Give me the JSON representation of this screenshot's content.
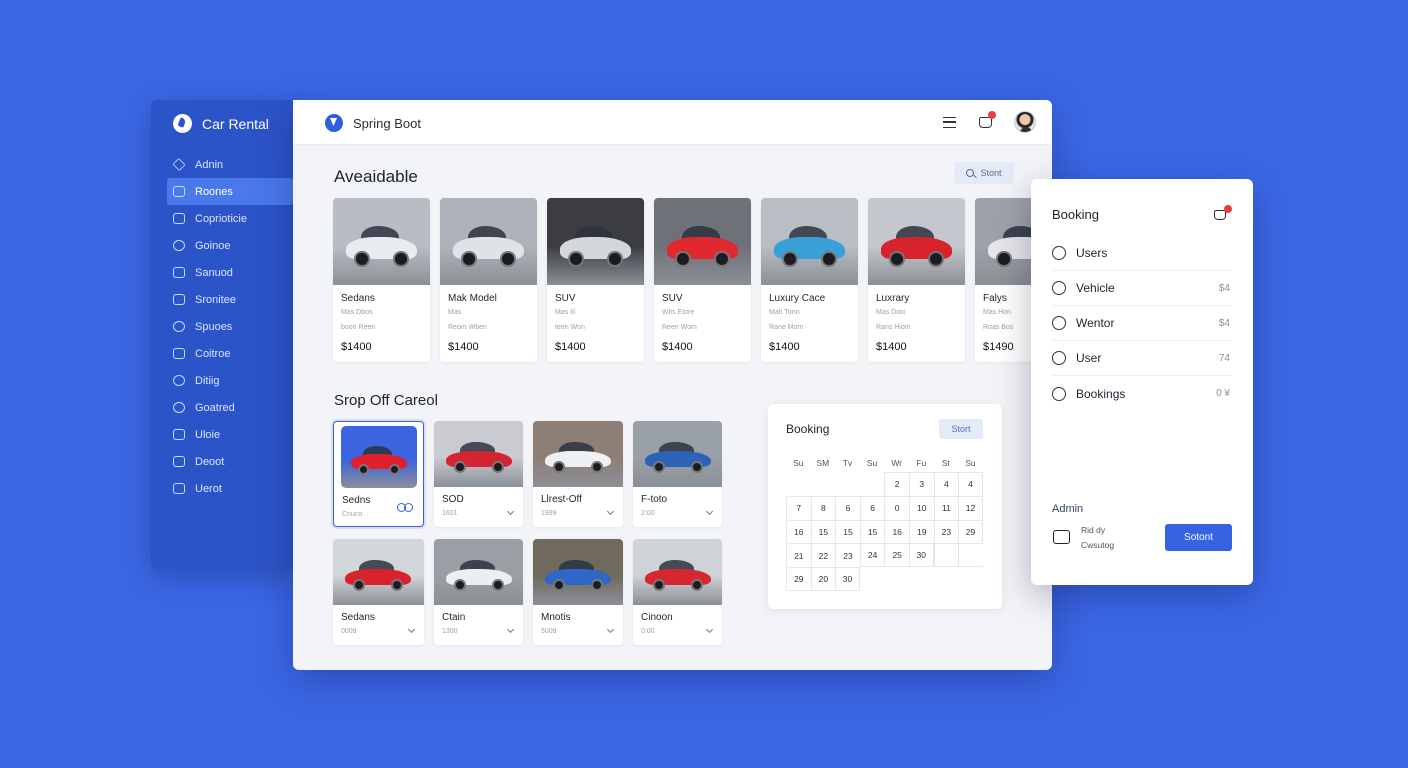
{
  "sidebar": {
    "brand": "Car Rental",
    "items": [
      {
        "label": "Adnin",
        "icon": "home-icon",
        "active": false
      },
      {
        "label": "Roones",
        "icon": "database-icon",
        "active": true
      },
      {
        "label": "Coprioticie",
        "icon": "lock-icon",
        "active": false
      },
      {
        "label": "Goinoe",
        "icon": "heart-icon",
        "active": false
      },
      {
        "label": "Sanuod",
        "icon": "card-icon",
        "active": false
      },
      {
        "label": "Sronitee",
        "icon": "chat-icon",
        "active": false
      },
      {
        "label": "Spuoes",
        "icon": "pin-icon",
        "active": false
      },
      {
        "label": "Coitroe",
        "icon": "square-icon",
        "active": false
      },
      {
        "label": "Ditiig",
        "icon": "check-icon",
        "active": false
      },
      {
        "label": "Goatred",
        "icon": "tag-icon",
        "active": false
      },
      {
        "label": "Uloie",
        "icon": "doc-icon",
        "active": false
      },
      {
        "label": "Deoot",
        "icon": "calendar-icon",
        "active": false
      },
      {
        "label": "Uerot",
        "icon": "list-icon",
        "active": false
      }
    ]
  },
  "topbar": {
    "title": "Spring Boot",
    "menu_icon": "hamburger-icon",
    "cart_icon": "cart-icon"
  },
  "available": {
    "heading": "Aveaidable",
    "search_label": "Stont",
    "cards": [
      {
        "title": "Sedans",
        "line1": "Mas Dbos",
        "line2": "boon Reen",
        "price": "$1400",
        "color": "#e9ecef",
        "bg": "#b8bdc5"
      },
      {
        "title": "Mak Model",
        "line1": "Mas",
        "line2": "Reom Wben",
        "price": "$1400",
        "color": "#dfe2e6",
        "bg": "#aeb3bb"
      },
      {
        "title": "SUV",
        "line1": "Mas Ili",
        "line2": "teen Won",
        "price": "$1400",
        "color": "#d3d6da",
        "bg": "#3b3d42"
      },
      {
        "title": "SUV",
        "line1": "Wits Etore",
        "line2": "Reen Wom",
        "price": "$1400",
        "color": "#e0292f",
        "bg": "#6e7178"
      },
      {
        "title": "Luxury Cace",
        "line1": "Mah Tonn",
        "line2": "Rane Mom",
        "price": "$1400",
        "color": "#3aa0d8",
        "bg": "#b9bdc4"
      },
      {
        "title": "Luxrary",
        "line1": "Mas Doio",
        "line2": "Rans Hiom",
        "price": "$1400",
        "color": "#d8232c",
        "bg": "#c4c8ce"
      },
      {
        "title": "Falys",
        "line1": "Mas Hon",
        "line2": "Roas Bos",
        "price": "$1490",
        "color": "#e4e6e9",
        "bg": "#9da2aa"
      }
    ]
  },
  "dropoff": {
    "heading": "Srop Off Careol",
    "cards": [
      {
        "title": "Sedns",
        "sub": "Cnuco",
        "selected": true,
        "color": "#e0202d",
        "bg": "#3b64de"
      },
      {
        "title": "SOD",
        "sub": "1601",
        "selected": false,
        "color": "#d42530",
        "bg": "#c9cbd0"
      },
      {
        "title": "Llrest-Off",
        "sub": "1999",
        "selected": false,
        "color": "#eef0f2",
        "bg": "#8d7f76"
      },
      {
        "title": "F-toto",
        "sub": "2:00",
        "selected": false,
        "color": "#2c62b8",
        "bg": "#9aa0a8"
      },
      {
        "title": "Sedans",
        "sub": "0009",
        "selected": false,
        "color": "#d8232c",
        "bg": "#d2d5da"
      },
      {
        "title": "Ctain",
        "sub": "1300",
        "selected": false,
        "color": "#eceef0",
        "bg": "#9a9ea5"
      },
      {
        "title": "Mnotis",
        "sub": "5009",
        "selected": false,
        "color": "#2f66c7",
        "bg": "#6f6a5c"
      },
      {
        "title": "Cinoon",
        "sub": "0:00",
        "selected": false,
        "color": "#d82630",
        "bg": "#cfd2d7"
      }
    ]
  },
  "calendar": {
    "title": "Booking",
    "button": "Stort",
    "days": [
      "Su",
      "SM",
      "Tv",
      "Su",
      "Wr",
      "Fu",
      "St",
      "Su"
    ],
    "rows": [
      [
        "",
        "",
        "",
        "",
        "2",
        "3",
        "4",
        "4"
      ],
      [
        "7",
        "8",
        "6",
        "6",
        "0",
        "10",
        "11",
        "12"
      ],
      [
        "16",
        "15",
        "15",
        "15",
        "16",
        "19",
        "23",
        "29"
      ],
      [
        "21",
        "22",
        "23",
        "24",
        "25",
        "30",
        "",
        ""
      ],
      [
        "29",
        "20",
        "30",
        "",
        "",
        "",
        "",
        ""
      ]
    ]
  },
  "booking": {
    "title": "Booking",
    "items": [
      {
        "label": "Users",
        "value": "",
        "icon": "users-icon"
      },
      {
        "label": "Vehicle",
        "value": "$4",
        "icon": "vehicle-icon"
      },
      {
        "label": "Wentor",
        "value": "$4",
        "icon": "vendor-icon"
      },
      {
        "label": "User",
        "value": "74",
        "icon": "user-icon"
      },
      {
        "label": "Bookings",
        "value": "0 ¥",
        "icon": "bookings-icon"
      }
    ],
    "admin_label": "Admin",
    "admin_line1": "Rid dy",
    "admin_line2": "Cwsutog",
    "submit": "Sotont"
  }
}
